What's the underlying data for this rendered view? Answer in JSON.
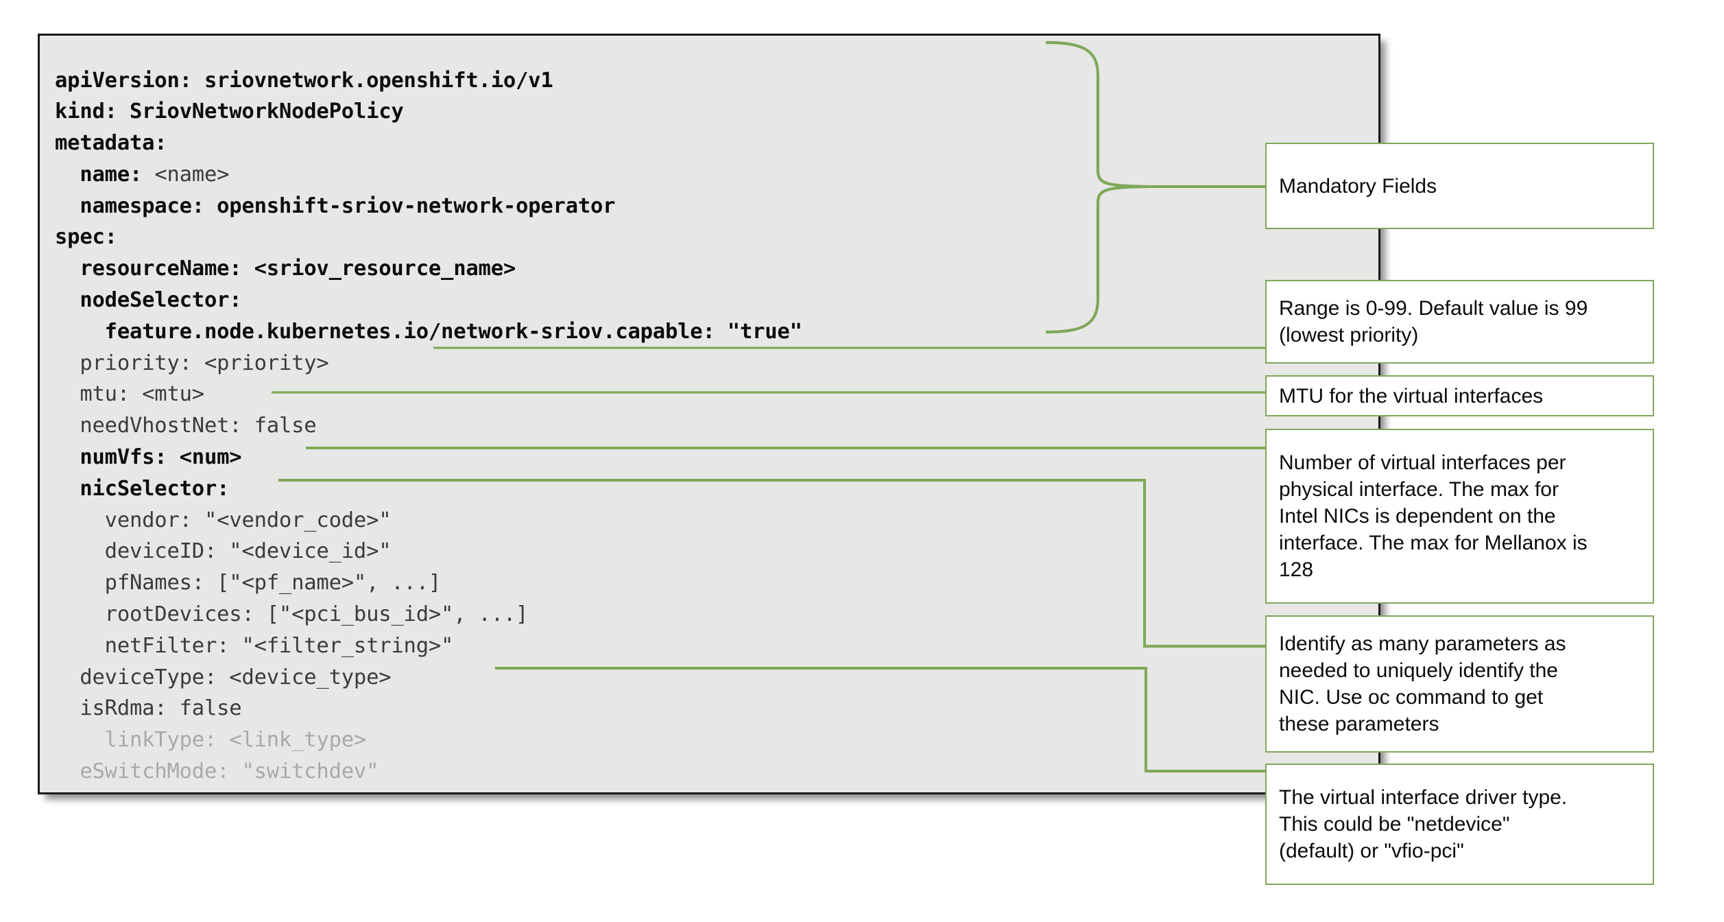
{
  "code_block": {
    "language": "yaml",
    "lines": [
      {
        "segments": [
          {
            "text": "apiVersion: sriovnetwork.openshift.io/v1",
            "style": "bold"
          }
        ]
      },
      {
        "segments": [
          {
            "text": "kind: SriovNetworkNodePolicy",
            "style": "bold"
          }
        ]
      },
      {
        "segments": [
          {
            "text": "metadata:",
            "style": "bold"
          }
        ]
      },
      {
        "segments": [
          {
            "text": "  name: ",
            "style": "bold"
          },
          {
            "text": "<name>",
            "style": "normal"
          }
        ]
      },
      {
        "segments": [
          {
            "text": "  namespace: openshift-sriov-network-operator",
            "style": "bold"
          }
        ]
      },
      {
        "segments": [
          {
            "text": "spec:",
            "style": "bold"
          }
        ]
      },
      {
        "segments": [
          {
            "text": "  resourceName: <sriov_resource_name>",
            "style": "bold"
          }
        ]
      },
      {
        "segments": [
          {
            "text": "  nodeSelector:",
            "style": "bold"
          }
        ]
      },
      {
        "segments": [
          {
            "text": "    feature.node.kubernetes.io/network-sriov.capable: \"true\"",
            "style": "bold"
          }
        ]
      },
      {
        "segments": [
          {
            "text": "  priority: <priority>",
            "style": "normal"
          }
        ]
      },
      {
        "segments": [
          {
            "text": "  mtu: <mtu>",
            "style": "normal"
          }
        ]
      },
      {
        "segments": [
          {
            "text": "  needVhostNet: false",
            "style": "normal"
          }
        ]
      },
      {
        "segments": [
          {
            "text": "  numVfs: <num>",
            "style": "bold"
          }
        ]
      },
      {
        "segments": [
          {
            "text": "  nicSelector:",
            "style": "bold"
          }
        ]
      },
      {
        "segments": [
          {
            "text": "    vendor: \"<vendor_code>\"",
            "style": "normal"
          }
        ]
      },
      {
        "segments": [
          {
            "text": "    deviceID: \"<device_id>\"",
            "style": "normal"
          }
        ]
      },
      {
        "segments": [
          {
            "text": "    pfNames: [\"<pf_name>\", ...]",
            "style": "normal"
          }
        ]
      },
      {
        "segments": [
          {
            "text": "    rootDevices: [\"<pci_bus_id>\", ...]",
            "style": "normal"
          }
        ]
      },
      {
        "segments": [
          {
            "text": "    netFilter: \"<filter_string>\"",
            "style": "normal"
          }
        ]
      },
      {
        "segments": [
          {
            "text": "  deviceType: <device_type>",
            "style": "normal"
          }
        ]
      },
      {
        "segments": [
          {
            "text": "  isRdma: false",
            "style": "normal"
          }
        ]
      },
      {
        "segments": [
          {
            "text": "    linkType: <link_type>",
            "style": "dim"
          }
        ]
      },
      {
        "segments": [
          {
            "text": "  eSwitchMode: \"switchdev\"",
            "style": "dim"
          }
        ]
      }
    ]
  },
  "callouts": {
    "mandatory": {
      "lines": [
        "Mandatory Fields"
      ]
    },
    "priority": {
      "lines": [
        "Range is 0-99. Default value is 99",
        "(lowest priority)"
      ]
    },
    "mtu": {
      "lines": [
        "MTU for the virtual interfaces"
      ]
    },
    "numvfs": {
      "lines": [
        "Number of virtual interfaces per",
        "physical interface. The max for",
        "Intel NICs is dependent on the",
        "interface. The max for Mellanox is",
        "128"
      ]
    },
    "nicselector": {
      "lines": [
        "Identify as many parameters as",
        "needed to uniquely identify the",
        "NIC. Use oc command to get",
        "these parameters"
      ]
    },
    "devicetype": {
      "lines": [
        "The virtual interface driver type.",
        "This could be \"netdevice\"",
        "(default) or \"vfio-pci\""
      ]
    }
  },
  "colors": {
    "callout_border": "#7fa85a",
    "connector_line": "#7fa85a",
    "code_background": "#e7e7e6",
    "code_border": "#1a1a1a",
    "code_text": "#111111",
    "code_dim_text": "#a9a9a9"
  }
}
